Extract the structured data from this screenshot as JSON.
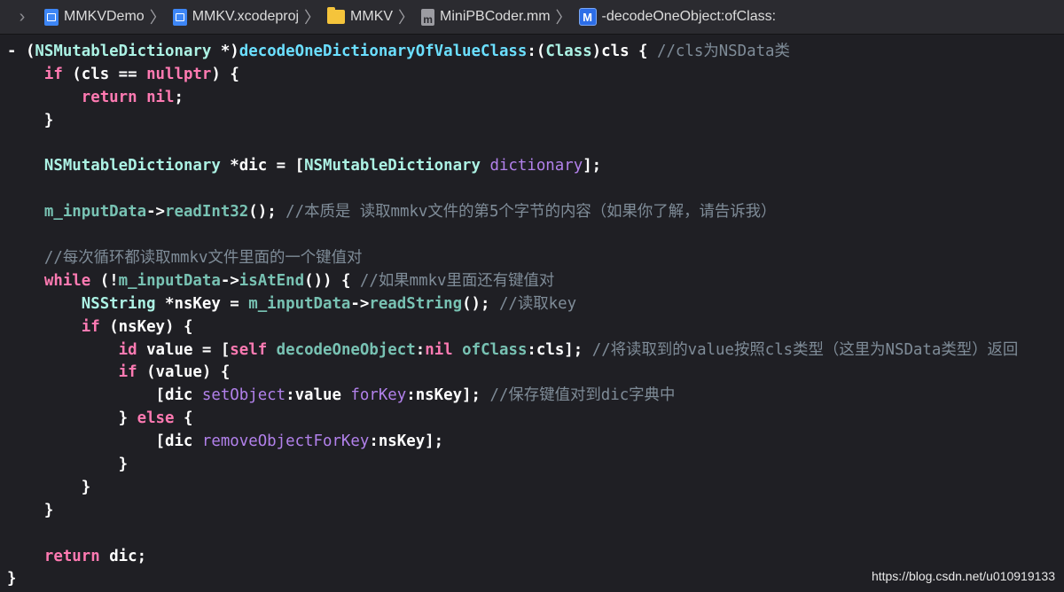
{
  "breadcrumbs": [
    {
      "icon": "project-file-icon",
      "label": "MMKVDemo"
    },
    {
      "icon": "xcodeproj-icon",
      "label": "MMKV.xcodeproj"
    },
    {
      "icon": "folder-icon",
      "label": "MMKV"
    },
    {
      "icon": "mm-file-icon",
      "label": "MiniPBCoder.mm"
    },
    {
      "icon": "method-icon",
      "label": "-decodeOneObject:ofClass:"
    }
  ],
  "icon_letters": {
    "mm_file": "m",
    "method": "M"
  },
  "code_lines": [
    [
      [
        "p",
        "- ("
      ],
      [
        "cls",
        "NSMutableDictionary"
      ],
      [
        "p",
        " *)"
      ],
      [
        "fn",
        "decodeOneDictionaryOfValueClass"
      ],
      [
        "p",
        ":("
      ],
      [
        "cls",
        "Class"
      ],
      [
        "p",
        ")cls { "
      ],
      [
        "cm",
        "//cls为NSData类"
      ]
    ],
    [
      [
        "p",
        "    "
      ],
      [
        "kw",
        "if"
      ],
      [
        "p",
        " (cls == "
      ],
      [
        "kw",
        "nullptr"
      ],
      [
        "p",
        ") {"
      ]
    ],
    [
      [
        "p",
        "        "
      ],
      [
        "kw",
        "return"
      ],
      [
        "p",
        " "
      ],
      [
        "kw",
        "nil"
      ],
      [
        "p",
        ";"
      ]
    ],
    [
      [
        "p",
        "    }"
      ]
    ],
    [],
    [
      [
        "p",
        "    "
      ],
      [
        "cls",
        "NSMutableDictionary"
      ],
      [
        "p",
        " *dic = ["
      ],
      [
        "cls",
        "NSMutableDictionary"
      ],
      [
        "p",
        " "
      ],
      [
        "me",
        "dictionary"
      ],
      [
        "p",
        "];"
      ]
    ],
    [],
    [
      [
        "p",
        "    "
      ],
      [
        "pr",
        "m_inputData"
      ],
      [
        "p",
        "->"
      ],
      [
        "pr",
        "readInt32"
      ],
      [
        "p",
        "(); "
      ],
      [
        "cm",
        "//本质是 读取mmkv文件的第5个字节的内容（如果你了解，请告诉我）"
      ]
    ],
    [],
    [
      [
        "p",
        "    "
      ],
      [
        "cm",
        "//每次循环都读取mmkv文件里面的一个键值对"
      ]
    ],
    [
      [
        "p",
        "    "
      ],
      [
        "kw",
        "while"
      ],
      [
        "p",
        " (!"
      ],
      [
        "pr",
        "m_inputData"
      ],
      [
        "p",
        "->"
      ],
      [
        "pr",
        "isAtEnd"
      ],
      [
        "p",
        "()) { "
      ],
      [
        "cm",
        "//如果mmkv里面还有键值对"
      ]
    ],
    [
      [
        "p",
        "        "
      ],
      [
        "cls",
        "NSString"
      ],
      [
        "p",
        " *nsKey = "
      ],
      [
        "pr",
        "m_inputData"
      ],
      [
        "p",
        "->"
      ],
      [
        "pr",
        "readString"
      ],
      [
        "p",
        "(); "
      ],
      [
        "cm",
        "//读取key"
      ]
    ],
    [
      [
        "p",
        "        "
      ],
      [
        "kw",
        "if"
      ],
      [
        "p",
        " (nsKey) {"
      ]
    ],
    [
      [
        "p",
        "            "
      ],
      [
        "kw",
        "id"
      ],
      [
        "p",
        " value = ["
      ],
      [
        "kw",
        "self"
      ],
      [
        "p",
        " "
      ],
      [
        "pr",
        "decodeOneObject"
      ],
      [
        "p",
        ":"
      ],
      [
        "kw",
        "nil"
      ],
      [
        "p",
        " "
      ],
      [
        "pr",
        "ofClass"
      ],
      [
        "p",
        ":cls]; "
      ],
      [
        "cm",
        "//将读取到的value按照cls类型（这里为NSData类型）返回"
      ]
    ],
    [
      [
        "p",
        "            "
      ],
      [
        "kw",
        "if"
      ],
      [
        "p",
        " (value) {"
      ]
    ],
    [
      [
        "p",
        "                [dic "
      ],
      [
        "me",
        "setObject"
      ],
      [
        "p",
        ":value "
      ],
      [
        "me",
        "forKey"
      ],
      [
        "p",
        ":nsKey]; "
      ],
      [
        "cm",
        "//保存键值对到dic字典中"
      ]
    ],
    [
      [
        "p",
        "            } "
      ],
      [
        "kw",
        "else"
      ],
      [
        "p",
        " {"
      ]
    ],
    [
      [
        "p",
        "                [dic "
      ],
      [
        "me",
        "removeObjectForKey"
      ],
      [
        "p",
        ":nsKey];"
      ]
    ],
    [
      [
        "p",
        "            }"
      ]
    ],
    [
      [
        "p",
        "        }"
      ]
    ],
    [
      [
        "p",
        "    }"
      ]
    ],
    [],
    [
      [
        "p",
        "    "
      ],
      [
        "kw",
        "return"
      ],
      [
        "p",
        " dic;"
      ]
    ],
    [
      [
        "p",
        "}"
      ]
    ]
  ],
  "watermark": "https://blog.csdn.net/u010919133",
  "colors": {
    "background": "#1f1f24",
    "keyword": "#ff7ab2",
    "comment": "#7f8c98",
    "class": "#acf2e4",
    "project_method": "#78c2b3",
    "system_method": "#b281eb",
    "declaration": "#6bdfff"
  }
}
